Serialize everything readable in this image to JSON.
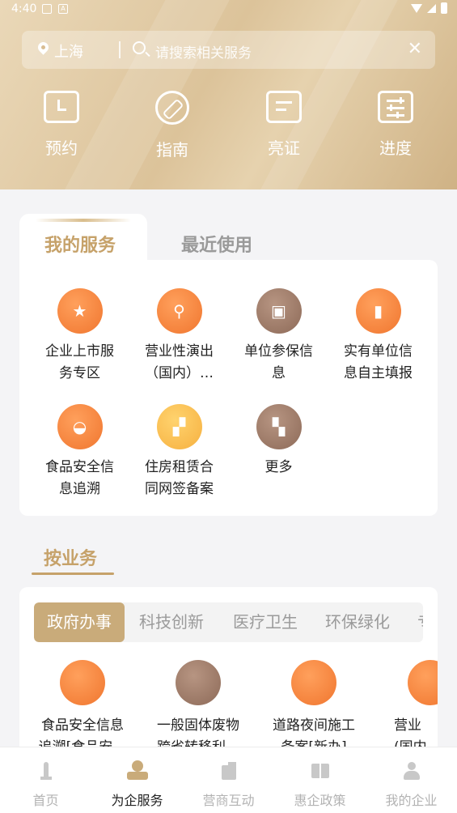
{
  "status_bar": {
    "time": "4:40"
  },
  "search": {
    "city": "上海",
    "placeholder": "请搜索相关服务"
  },
  "quick_actions": [
    {
      "label": "预约",
      "icon": "calendar-clock-icon"
    },
    {
      "label": "指南",
      "icon": "compass-icon"
    },
    {
      "label": "亮证",
      "icon": "document-icon"
    },
    {
      "label": "进度",
      "icon": "sliders-icon"
    }
  ],
  "service_tabs": {
    "active": "我的服务",
    "other": "最近使用"
  },
  "my_services": [
    {
      "label": "企业上市服\n务专区",
      "icon": "star-flag-icon",
      "color": "#f0762f"
    },
    {
      "label": "营业性演出\n（国内）…",
      "icon": "magnifier-icon",
      "color": "#f0762f"
    },
    {
      "label": "单位参保信\n息",
      "icon": "id-card-icon",
      "color": "#8d6a58"
    },
    {
      "label": "实有单位信\n息自主填报",
      "icon": "bookmark-icon",
      "color": "#f0762f"
    },
    {
      "label": "食品安全信\n息追溯",
      "icon": "meat-icon",
      "color": "#f0762f"
    },
    {
      "label": "住房租赁合\n同网签备案",
      "icon": "blocks-icon",
      "color": "#f6b040"
    },
    {
      "label": "更多",
      "icon": "grid-more-icon",
      "color": "#8d6a58"
    }
  ],
  "business_section": {
    "title": "按业务",
    "categories": [
      "政府办事",
      "科技创新",
      "医疗卫生",
      "环保绿化",
      "专"
    ],
    "items": [
      {
        "label": "食品安全信息\n追溯[食品安…",
        "icon": "meat-icon",
        "color": "#f0762f"
      },
      {
        "label": "一般固体废物\n跨省转移利…",
        "icon": "hexagon-recycle-icon",
        "color": "#8d6a58"
      },
      {
        "label": "道路夜间施工\n备案[新办]",
        "icon": "tools-icon",
        "color": "#f0762f"
      },
      {
        "label": "营业\n(国内",
        "icon": "magnifier-icon",
        "color": "#f0762f"
      }
    ]
  },
  "tab_bar": {
    "items": [
      {
        "label": "首页",
        "icon": "tower-icon"
      },
      {
        "label": "为企服务",
        "icon": "stamp-icon",
        "active": true
      },
      {
        "label": "营商互动",
        "icon": "building-icon"
      },
      {
        "label": "惠企政策",
        "icon": "book-icon"
      },
      {
        "label": "我的企业",
        "icon": "person-icon"
      }
    ]
  }
}
